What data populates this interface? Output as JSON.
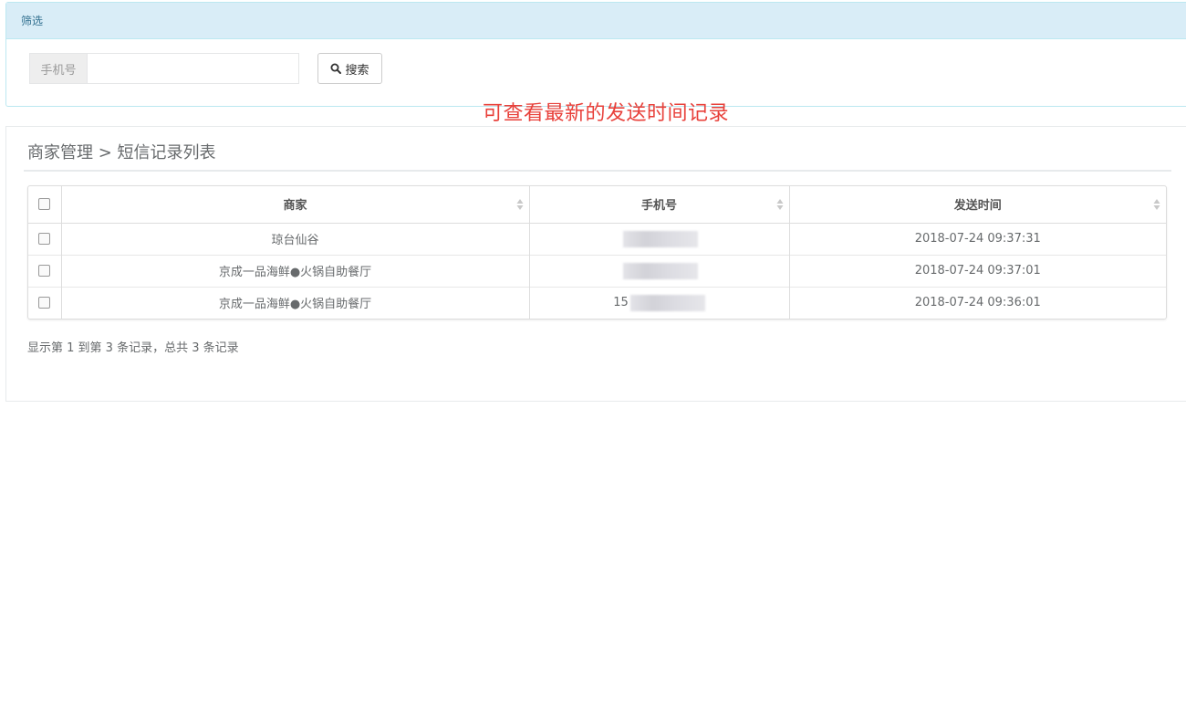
{
  "filter": {
    "heading": "筛选",
    "phone_label": "手机号",
    "phone_value": "",
    "phone_placeholder": "",
    "search_label": "搜索"
  },
  "annotation": "可查看最新的发送时间记录",
  "list": {
    "breadcrumb": "商家管理 > 短信记录列表",
    "columns": [
      "商家",
      "手机号",
      "发送时间"
    ],
    "rows": [
      {
        "merchant": "琼台仙谷",
        "phone_prefix": "",
        "time": "2018-07-24 09:37:31"
      },
      {
        "merchant": "京成一品海鲜●火锅自助餐厅",
        "phone_prefix": "",
        "time": "2018-07-24 09:37:01"
      },
      {
        "merchant": "京成一品海鲜●火锅自助餐厅",
        "phone_prefix": "15",
        "time": "2018-07-24 09:36:01"
      }
    ],
    "pagination_info": "显示第 1 到第 3 条记录，总共 3 条记录"
  }
}
